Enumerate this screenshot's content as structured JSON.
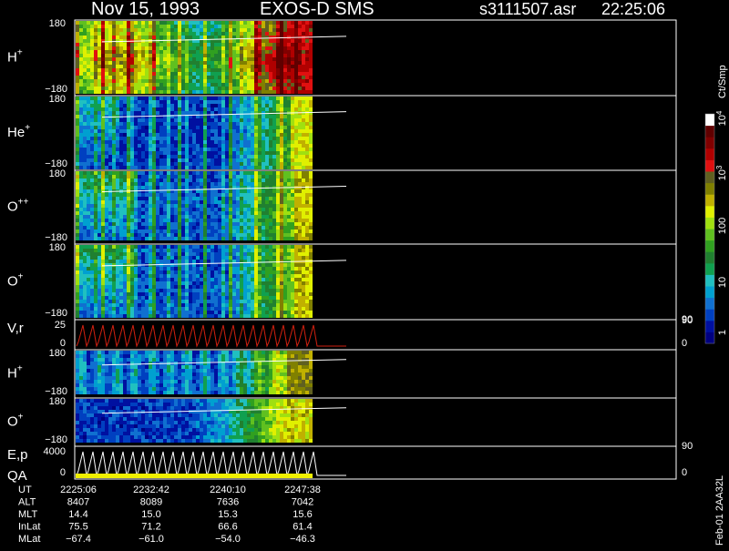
{
  "header": {
    "date": "Nov 15, 1993",
    "instrument": "EXOS-D SMS",
    "file": "s3111507.asr",
    "time": "22:25:06"
  },
  "colorbar": {
    "unit": "Ct/Smp",
    "ticks": [
      {
        "label": "1",
        "value": 1
      },
      {
        "label": "10",
        "value": 10
      },
      {
        "label": "100",
        "value": 100
      },
      {
        "label": "10",
        "sup": "3",
        "value": 1000
      },
      {
        "label": "10",
        "sup": "4",
        "value": 10000
      }
    ],
    "colors": [
      "#000080",
      "#0010a0",
      "#0040c0",
      "#1070d0",
      "#00a0d0",
      "#20c0c0",
      "#10a050",
      "#208030",
      "#30a020",
      "#60c020",
      "#a0e010",
      "#e0f000",
      "#c0b000",
      "#808000",
      "#606020",
      "#e01010",
      "#b00000",
      "#800000",
      "#600000",
      "#ffffff"
    ]
  },
  "footer": {
    "rows": [
      {
        "label": "UT",
        "values": [
          "2225:06",
          "2232:42",
          "2240:10",
          "2247:38"
        ]
      },
      {
        "label": "ALT",
        "values": [
          "8407",
          "8089",
          "7636",
          "7042"
        ]
      },
      {
        "label": "MLT",
        "values": [
          "14.4",
          "15.0",
          "15.3",
          "15.6"
        ]
      },
      {
        "label": "InLat",
        "values": [
          "75.5",
          "71.2",
          "66.6",
          "61.4"
        ]
      },
      {
        "label": "MLat",
        "values": [
          "-67.4",
          "-61.0",
          "-54.0",
          "-46.3"
        ]
      }
    ],
    "side_text": "Feb-01 2AA32L"
  },
  "chart_data": {
    "type": "heatmap",
    "x_label": "UT",
    "x_ticks": [
      "2225:06",
      "2232:42",
      "2240:10",
      "2247:38"
    ],
    "panels": [
      {
        "name": "H",
        "sup": "+",
        "kind": "pitch",
        "ytop": "180",
        "ybot": "-180",
        "ylim": [
          -180,
          180
        ],
        "profile": "h1"
      },
      {
        "name": "He",
        "sup": "+",
        "kind": "pitch",
        "ytop": "180",
        "ybot": "-180",
        "ylim": [
          -180,
          180
        ],
        "profile": "he"
      },
      {
        "name": "O",
        "sup": "++",
        "kind": "pitch",
        "ytop": "180",
        "ybot": "-180",
        "ylim": [
          -180,
          180
        ],
        "profile": "opp"
      },
      {
        "name": "O",
        "sup": "+",
        "kind": "pitch",
        "ytop": "180",
        "ybot": "-180",
        "ylim": [
          -180,
          180
        ],
        "profile": "op",
        "right_label": "90"
      },
      {
        "name": "V,r",
        "sup": "",
        "kind": "line",
        "ytop": "25",
        "ybot": "0",
        "ylim": [
          0,
          25
        ],
        "right_top": "90",
        "right_bot": "0",
        "color": "#d02010"
      },
      {
        "name": "H",
        "sup": "+",
        "kind": "pitch",
        "ytop": "180",
        "ybot": "-180",
        "ylim": [
          -180,
          180
        ],
        "profile": "h2"
      },
      {
        "name": "O",
        "sup": "+",
        "kind": "pitch",
        "ytop": "180",
        "ybot": "-180",
        "ylim": [
          -180,
          180
        ],
        "profile": "o2",
        "right_label": "90"
      },
      {
        "name": "E,p",
        "sup": "",
        "name2": "QA",
        "kind": "line",
        "ytop": "4000",
        "ybot": "0",
        "ylim": [
          0,
          4000
        ],
        "right_bot": "0",
        "color": "#ffffff"
      }
    ]
  }
}
